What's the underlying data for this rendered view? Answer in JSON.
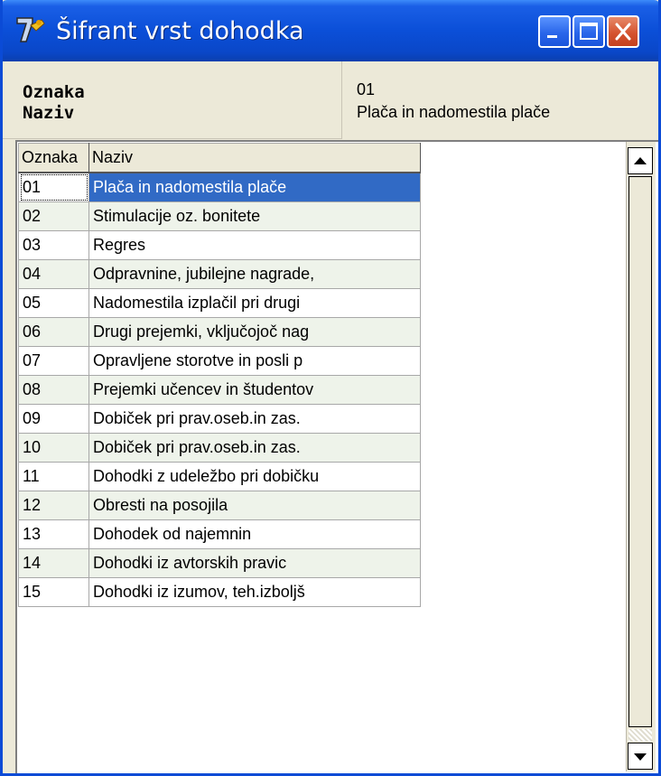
{
  "window": {
    "title": "Šifrant vrst dohodka",
    "controls": {
      "minimize": "minimize-icon",
      "maximize": "maximize-icon",
      "close": "close-icon"
    }
  },
  "info": {
    "labels": [
      "Oznaka",
      "Naziv"
    ],
    "selected_oznaka": "01",
    "selected_naziv": "Plača in nadomestila plače"
  },
  "grid": {
    "columns": [
      "Oznaka",
      "Naziv"
    ],
    "rows": [
      {
        "oznaka": "01",
        "naziv": "Plača in nadomestila plače"
      },
      {
        "oznaka": "02",
        "naziv": "Stimulacije oz. bonitete"
      },
      {
        "oznaka": "03",
        "naziv": "Regres"
      },
      {
        "oznaka": "04",
        "naziv": "Odpravnine, jubilejne nagrade,"
      },
      {
        "oznaka": "05",
        "naziv": "Nadomestila izplačil pri drugi"
      },
      {
        "oznaka": "06",
        "naziv": "Drugi prejemki, vključojoč nag"
      },
      {
        "oznaka": "07",
        "naziv": "Opravljene storotve in posli p"
      },
      {
        "oznaka": "08",
        "naziv": "Prejemki učencev in študentov"
      },
      {
        "oznaka": "09",
        "naziv": "Dobiček pri prav.oseb.in zas."
      },
      {
        "oznaka": "10",
        "naziv": "Dobiček pri prav.oseb.in zas."
      },
      {
        "oznaka": "11",
        "naziv": "Dohodki z udeležbo pri dobičku"
      },
      {
        "oznaka": "12",
        "naziv": "Obresti na posojila"
      },
      {
        "oznaka": "13",
        "naziv": "Dohodek od najemnin"
      },
      {
        "oznaka": "14",
        "naziv": "Dohodki iz avtorskih pravic"
      },
      {
        "oznaka": "15",
        "naziv": "Dohodki iz izumov, teh.izboljš"
      }
    ],
    "selected_row": "01"
  },
  "colors": {
    "selection": "#316ac5",
    "alt_row": "#eef3ea",
    "titlebar": "#0b4fd8"
  }
}
